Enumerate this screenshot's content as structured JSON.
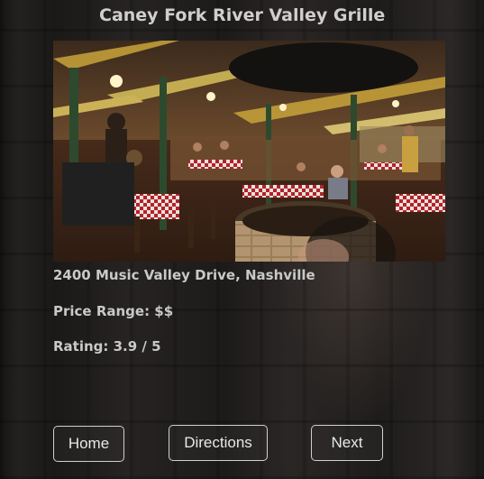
{
  "page": {
    "title": "Caney Fork River Valley Grille"
  },
  "restaurant": {
    "address": "2400 Music Valley Drive, Nashville",
    "price_range": "Price Range: $$",
    "rating": "Rating: 3.9 / 5",
    "photo_alt": "Caney Fork River Valley Grille"
  },
  "nav": {
    "home_label": "Home",
    "directions_label": "Directions",
    "next_label": "Next"
  },
  "colors": {
    "text": "#c9c9c9",
    "button_border": "#d0d0d0"
  }
}
